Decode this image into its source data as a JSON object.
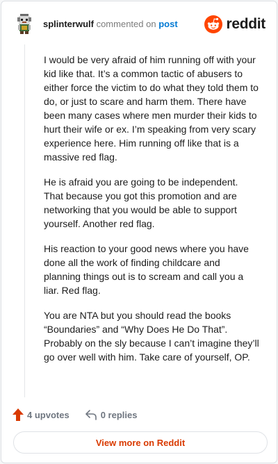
{
  "comment": {
    "author": "splinterwulf",
    "commented_on_text": "commented on",
    "post_link": "post",
    "paragraphs": [
      "I would be very afraid of him running off with your kid like that. It’s a common tactic of abusers to either force the victim to do what they told them to do, or just to scare and harm them. There have been many cases where men murder their kids to hurt their wife or ex. I’m speaking from very scary experience here. Him running off like that is a massive red flag.",
      "He is afraid you are going to be independent. That because you got this promotion and are networking that you would be able to support yourself. Another red flag.",
      "His reaction to your good news where you have done all the work of finding childcare and planning things out is to scream and call you a liar. Red flag.",
      "You are NTA but you should read the books “Boundaries” and “Why Does He Do That”. Probably on the sly because I can’t imagine they’ll go over well with him. Take care of yourself, OP."
    ],
    "upvotes_label": "4 upvotes",
    "replies_label": "0 replies"
  },
  "brand": {
    "name": "reddit",
    "icon": "reddit-logo-icon"
  },
  "footer": {
    "view_more_label": "View more on Reddit"
  },
  "colors": {
    "brand_orange": "#ff4500",
    "upvote_orange": "#d93a00",
    "link_blue": "#0079d3",
    "text": "#1c1c1c",
    "muted": "#7c7c7c"
  }
}
